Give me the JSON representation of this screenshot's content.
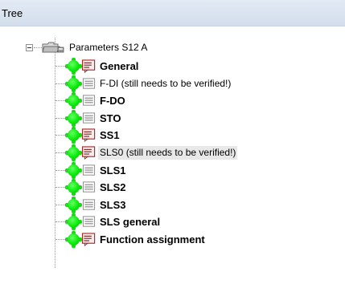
{
  "header": {
    "title": "Tree"
  },
  "tree": {
    "root": {
      "label": "Parameters S12 A",
      "icon": "folder-icon",
      "expanded": true
    },
    "items": [
      {
        "label": "General",
        "bold": true,
        "icon": "red-document-icon",
        "status": "green",
        "selected": false
      },
      {
        "label": "F-DI (still needs to be verified!)",
        "bold": false,
        "icon": "gray-document-icon",
        "status": "green",
        "selected": false
      },
      {
        "label": "F-DO",
        "bold": true,
        "icon": "gray-document-icon",
        "status": "green",
        "selected": false
      },
      {
        "label": "STO",
        "bold": true,
        "icon": "gray-document-icon",
        "status": "green",
        "selected": false
      },
      {
        "label": "SS1",
        "bold": true,
        "icon": "red-document-icon",
        "status": "green",
        "selected": false
      },
      {
        "label": "SLS0 (still needs to be verified!)",
        "bold": false,
        "icon": "red-document-icon",
        "status": "green",
        "selected": true
      },
      {
        "label": "SLS1",
        "bold": true,
        "icon": "gray-document-icon",
        "status": "green",
        "selected": false
      },
      {
        "label": "SLS2",
        "bold": true,
        "icon": "gray-document-icon",
        "status": "green",
        "selected": false
      },
      {
        "label": "SLS3",
        "bold": true,
        "icon": "gray-document-icon",
        "status": "green",
        "selected": false
      },
      {
        "label": "SLS general",
        "bold": true,
        "icon": "gray-document-icon",
        "status": "green",
        "selected": false
      },
      {
        "label": "Function assignment",
        "bold": true,
        "icon": "red-document-icon",
        "status": "green",
        "selected": false
      }
    ]
  },
  "colors": {
    "header_bg": "#d9e3f0",
    "status_green": "#11ee11",
    "red_icon_border": "#a52a2a"
  }
}
